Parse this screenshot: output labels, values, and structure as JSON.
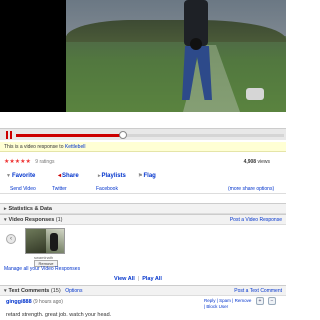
{
  "response_note": {
    "prefix": "This is a video response to",
    "link": "Kettlebell"
  },
  "ratings": {
    "stars": "★★★★★",
    "count": "9 ratings",
    "views_number": "4,908",
    "views_label": "views"
  },
  "actions": {
    "favorite": "Favorite",
    "share": "Share",
    "playlists": "Playlists",
    "flag": "Flag"
  },
  "share_row": {
    "send": "Send Video",
    "twitter": "Twitter",
    "facebook": "Facebook",
    "more": "(more share options)"
  },
  "sections": {
    "stats": "Statistics & Data",
    "video_responses": "Video Responses",
    "video_responses_count": "(1)",
    "post_video_response": "Post a Video Response",
    "text_comments": "Text Comments",
    "text_comments_count": "(15)",
    "options": "Options",
    "post_text_comment": "Post a Text Comment"
  },
  "video_response": {
    "name": "swaminath",
    "button": "Remove",
    "manage": "Manage all your Video Responses",
    "view_all": "View All",
    "play_all": "Play All"
  },
  "comment": {
    "user": "ginggi888",
    "time": "(9 hours ago)",
    "actions": "Reply | Spam | Remove | Block User",
    "text": "retard strength. great job. watch your head."
  },
  "player": {
    "progress": 0.4
  },
  "colors": {
    "accent": "#cc0000",
    "link": "#0033cc",
    "note_bg": "#ffffd4"
  }
}
